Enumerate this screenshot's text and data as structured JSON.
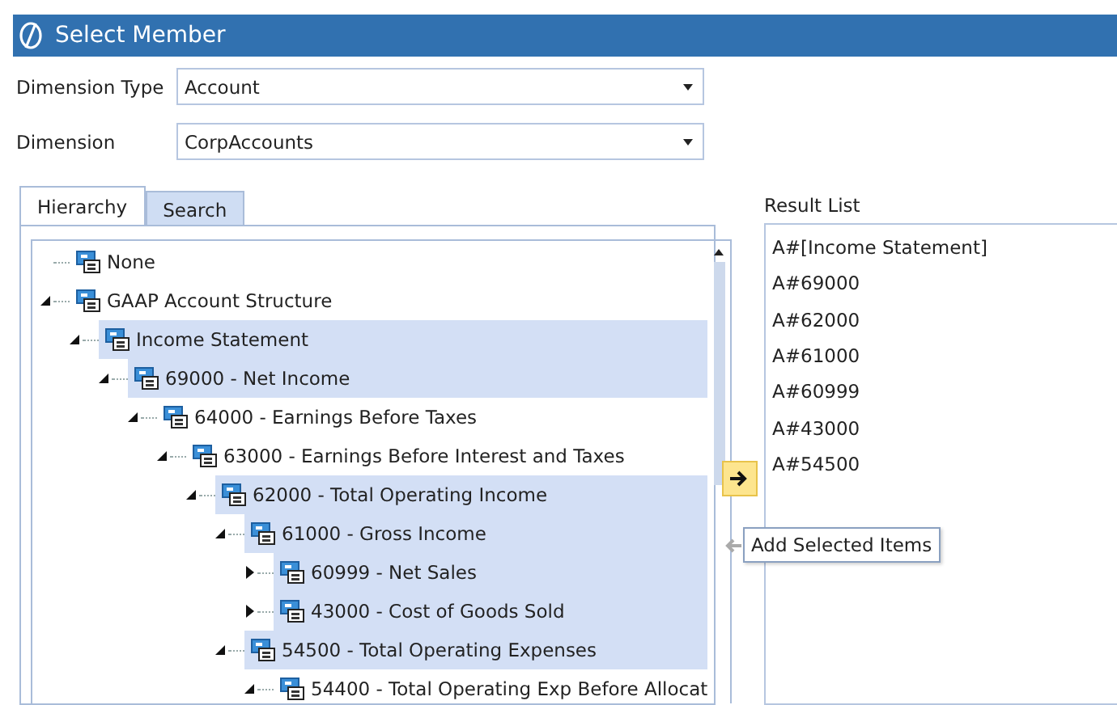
{
  "window": {
    "title": "Select Member"
  },
  "fields": [
    {
      "label": "Dimension Type",
      "value": "Account"
    },
    {
      "label": "Dimension",
      "value": "CorpAccounts"
    }
  ],
  "tabs": [
    {
      "label": "Hierarchy",
      "selected": true
    },
    {
      "label": "Search",
      "selected": false
    }
  ],
  "tree": [
    {
      "label": "None",
      "selected": false
    },
    {
      "label": "GAAP Account Structure",
      "selected": false,
      "expanded": true,
      "children": [
        {
          "label": "Income Statement",
          "selected": true,
          "expanded": true,
          "children": [
            {
              "label": "69000 - Net Income",
              "selected": true,
              "expanded": true,
              "children": [
                {
                  "label": "64000 - Earnings Before Taxes",
                  "selected": false,
                  "expanded": true,
                  "children": [
                    {
                      "label": "63000 - Earnings Before Interest and Taxes",
                      "selected": false,
                      "expanded": true,
                      "children": [
                        {
                          "label": "62000 - Total Operating Income",
                          "selected": true,
                          "expanded": true,
                          "children": [
                            {
                              "label": "61000 - Gross Income",
                              "selected": true,
                              "expanded": true,
                              "children": [
                                {
                                  "label": "60999 - Net Sales",
                                  "selected": true,
                                  "expanded": false
                                },
                                {
                                  "label": "43000 - Cost of Goods Sold",
                                  "selected": true,
                                  "expanded": false
                                }
                              ]
                            },
                            {
                              "label": "54500 - Total Operating Expenses",
                              "selected": true,
                              "expanded": true,
                              "children": [
                                {
                                  "label": "54400 - Total Operating Exp Before Allocat",
                                  "selected": false,
                                  "expanded": true
                                }
                              ]
                            }
                          ]
                        }
                      ]
                    }
                  ]
                }
              ]
            }
          ]
        }
      ]
    }
  ],
  "result_list": {
    "label": "Result List",
    "items": [
      "A#[Income Statement]",
      "A#69000",
      "A#62000",
      "A#61000",
      "A#60999",
      "A#43000",
      "A#54500"
    ]
  },
  "tooltip": "Add Selected Items"
}
